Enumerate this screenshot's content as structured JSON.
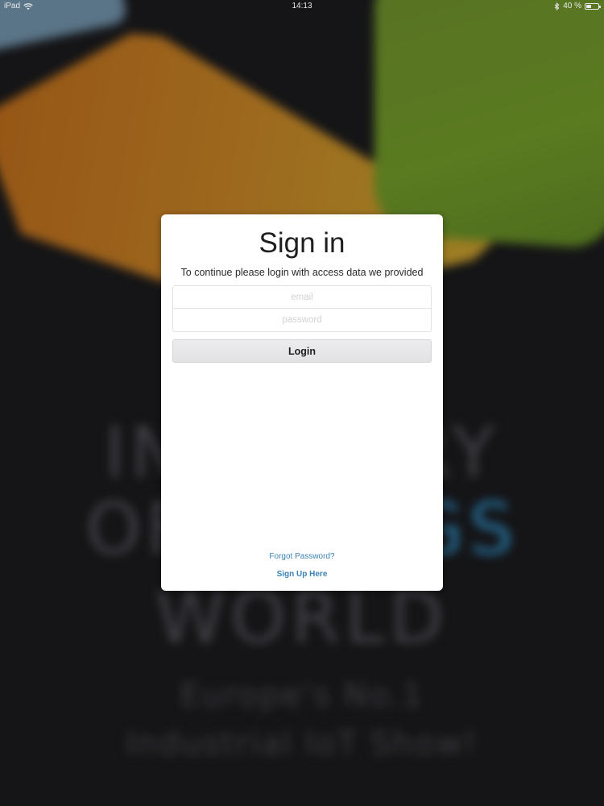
{
  "status_bar": {
    "device": "iPad",
    "time": "14:13",
    "battery_text": "40 %",
    "battery_level": 0.4,
    "icons": [
      "wifi-icon",
      "bluetooth-icon",
      "battery-icon"
    ]
  },
  "background": {
    "line1": "INDUSTRY",
    "line2_start": "OF ",
    "line2_highlight": "THINGS",
    "line3": "WORLD",
    "line4": "Europe's No.1",
    "line5": "Industrial IoT Show!",
    "colors": {
      "orange": "#c98526",
      "green": "#6e9628",
      "blue": "#6f8fa6",
      "highlight": "#2f86b8"
    }
  },
  "signin": {
    "title": "Sign in",
    "subtitle": "To continue please login with access data we provided",
    "email_placeholder": "email",
    "email_value": "",
    "password_placeholder": "password",
    "password_value": "",
    "login_label": "Login",
    "forgot_label": "Forgot Password?",
    "signup_label": "Sign Up Here",
    "link_color": "#3a83b8"
  }
}
